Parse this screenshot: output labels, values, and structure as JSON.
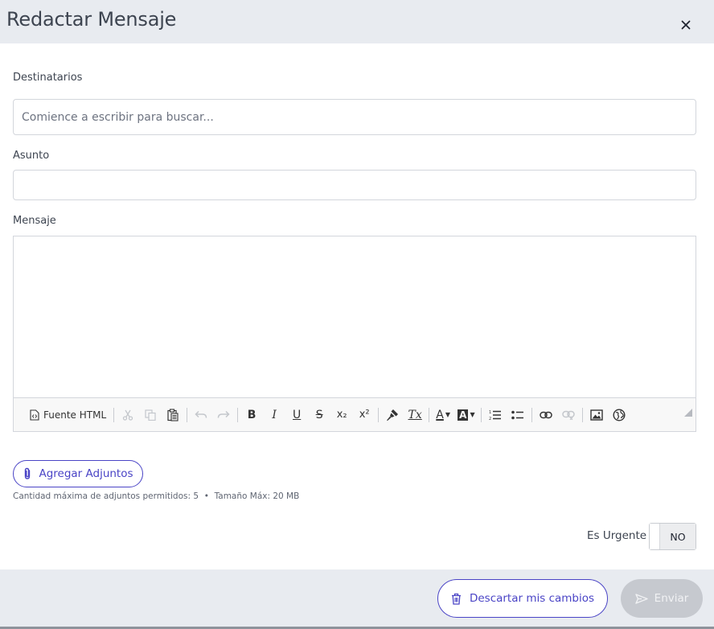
{
  "dialog": {
    "title": "Redactar Mensaje",
    "close_label": "×"
  },
  "recipients": {
    "label": "Destinatarios",
    "placeholder": "Comience a escribir para buscar...",
    "value": ""
  },
  "subject": {
    "label": "Asunto",
    "value": ""
  },
  "message": {
    "label": "Mensaje",
    "value": "",
    "toolbar": {
      "source_label": "Fuente HTML",
      "buttons": {
        "cut": "cut-icon",
        "copy": "copy-icon",
        "paste": "paste-icon",
        "undo": "undo-icon",
        "redo": "redo-icon",
        "bold": "B",
        "italic": "I",
        "underline": "U",
        "strike": "S",
        "subscript": "x₂",
        "superscript": "x²",
        "copy_format": "paint-brush-icon",
        "remove_format": "Tx",
        "text_color": "A",
        "bg_color": "A",
        "numbered_list": "numbered-list-icon",
        "bulleted_list": "bulleted-list-icon",
        "link": "link-icon",
        "unlink": "unlink-icon",
        "image": "image-icon",
        "iframe": "globe-icon"
      }
    }
  },
  "attachments": {
    "button_label": "Agregar Adjuntos",
    "info": "Cantidad máxima de adjuntos permitidos: 5  •  Tamaño Máx: 20 MB"
  },
  "urgent": {
    "label": "Es Urgente",
    "toggle_label": "NO",
    "value": false
  },
  "footer": {
    "discard_label": "Descartar mis cambios",
    "send_label": "Enviar",
    "send_enabled": false
  },
  "colors": {
    "accent": "#4a44c6",
    "header_bg": "#e8ebf0",
    "disabled_button": "#c6c9cf"
  }
}
